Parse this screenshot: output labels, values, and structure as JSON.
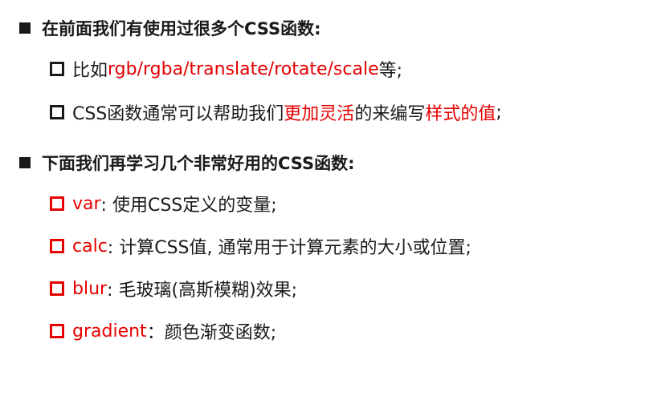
{
  "colors": {
    "text": "#1a1a1a",
    "accent_red": "#e60000"
  },
  "section1": {
    "heading": "在前面我们有使用过很多个CSS函数:",
    "items": [
      {
        "prefix": "比如",
        "highlight": "rgb/rgba/translate/rotate/scale",
        "suffix": "等;"
      },
      {
        "prefix": "CSS函数通常可以帮助我们",
        "highlight": "更加灵活",
        "middle": "的来编写",
        "highlight2": "样式的值",
        "suffix": ";"
      }
    ]
  },
  "section2": {
    "heading": "下面我们再学习几个非常好用的CSS函数:",
    "items": [
      {
        "name": "var",
        "desc": ": 使用CSS定义的变量;"
      },
      {
        "name": "calc",
        "desc": ": 计算CSS值, 通常用于计算元素的大小或位置;"
      },
      {
        "name": "blur",
        "desc": ": 毛玻璃(高斯模糊)效果;"
      },
      {
        "name": "gradient",
        "desc": "：颜色渐变函数;"
      }
    ]
  }
}
